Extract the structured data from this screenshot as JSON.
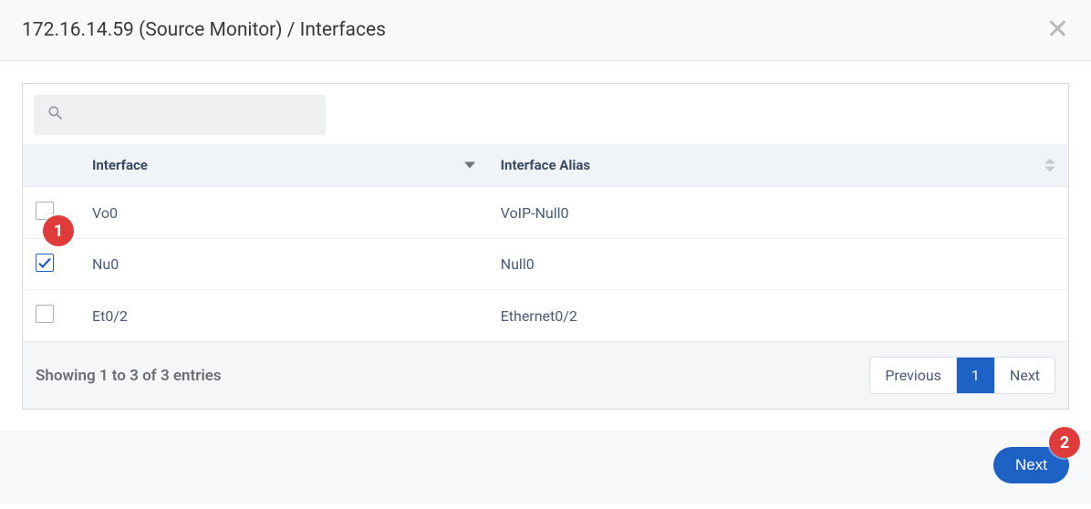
{
  "header": {
    "title": "172.16.14.59 (Source Monitor) / Interfaces"
  },
  "search": {
    "placeholder": ""
  },
  "columns": {
    "interface": "Interface",
    "alias": "Interface Alias"
  },
  "rows": [
    {
      "checked": false,
      "interface": "Vo0",
      "alias": "VoIP-Null0"
    },
    {
      "checked": true,
      "interface": "Nu0",
      "alias": "Null0"
    },
    {
      "checked": false,
      "interface": "Et0/2",
      "alias": "Ethernet0/2"
    }
  ],
  "footer": {
    "entries_text": "Showing 1 to 3 of 3 entries",
    "prev": "Previous",
    "page": "1",
    "next": "Next"
  },
  "action": {
    "next": "Next"
  },
  "callouts": {
    "c1": "1",
    "c2": "2"
  }
}
